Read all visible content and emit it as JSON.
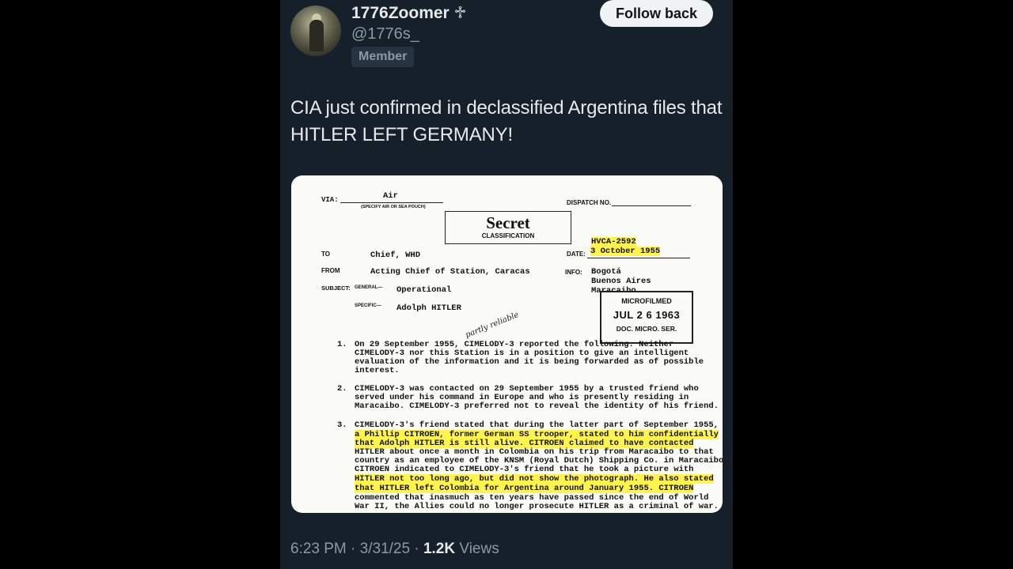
{
  "author": {
    "display_name": "1776Zoomer ♱",
    "handle": "@1776s_",
    "badge": "Member"
  },
  "actions": {
    "follow_label": "Follow back"
  },
  "tweet": {
    "text": "CIA just confirmed in declassified Argentina files that HITLER LEFT GERMANY!"
  },
  "document": {
    "via_label": "VIA:",
    "via_value": "Air",
    "via_hint": "(SPECIFY AIR OR SEA POUCH)",
    "dispatch_label": "DISPATCH NO.",
    "classification": "Secret",
    "classification_label": "CLASSIFICATION",
    "dispatch_number": "HVCA-2592",
    "date_label": "DATE:",
    "date_value": "3 October 1955",
    "to_label": "TO",
    "to_value": "Chief, WHD",
    "from_label": "FROM",
    "from_value": "Acting Chief of Station, Caracas",
    "info_label": "INFO:",
    "info_values": [
      "Bogotá",
      "Buenos Aires",
      "Maracaibo"
    ],
    "subject_label": "SUBJECT:",
    "general_label": "GENERAL—",
    "general_value": "Operational",
    "specific_label": "SPECIFIC—",
    "specific_value": "Adolph HITLER",
    "stamp": {
      "line1": "MICROFILMED",
      "line2": "JUL 2 6 1963",
      "line3": "DOC. MICRO. SER."
    },
    "handwriting": "partly reliable",
    "paragraphs": [
      {
        "num": "1.",
        "lines": [
          "On 29 September 1955, CIMELODY-3 reported the following. Neither",
          "CIMELODY-3 nor this Station is in a position to give an intelligent",
          "evaluation of the information and it is being forwarded as of possible",
          "interest."
        ]
      },
      {
        "num": "2.",
        "lines": [
          "CIMELODY-3 was contacted on 29 September 1955 by a trusted friend who",
          "served under his command in Europe and who is presently residing in",
          "Maracaibo. CIMELODY-3 preferred not to reveal the identity of his friend."
        ]
      },
      {
        "num": "3.",
        "lines": [
          "CIMELODY-3's friend stated that during the latter part of September 1955,",
          "a Phillip CITROEN, former German SS trooper, stated to him confidentially",
          "that Adolph HITLER is still alive. CITROEN claimed to have contacted",
          "HITLER about once a month in Colombia on his trip from Maracaibo to that",
          "country as an employee of the KNSM (Royal Dutch) Shipping Co. in Maracaibo.",
          "CITROEN indicated to CIMELODY-3's friend that he took a picture with",
          "HITLER not too long ago, but did not show the photograph. He also stated",
          "that HITLER left Colombia for Argentina around January 1955. CITROEN",
          "commented that inasmuch as ten years have passed since the end of World",
          "War II, the Allies could no longer prosecute HITLER as a criminal of war."
        ]
      }
    ]
  },
  "footer": {
    "time": "6:23 PM",
    "date": "3/31/25",
    "views_count": "1.2K",
    "views_label": "Views",
    "separator": "·"
  }
}
